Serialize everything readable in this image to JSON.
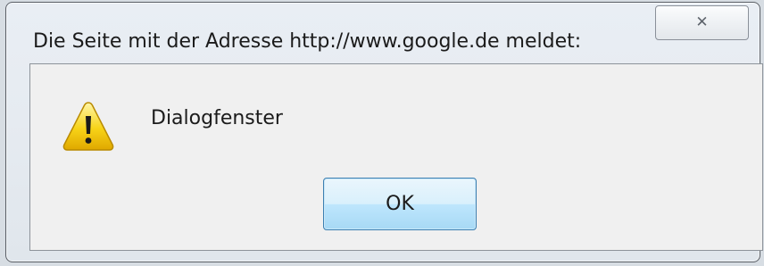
{
  "window": {
    "title": "Die Seite mit der Adresse http://www.google.de meldet:",
    "close_icon": "close-icon"
  },
  "dialog": {
    "icon": "warning-icon",
    "message": "Dialogfenster",
    "ok_label": "OK"
  },
  "colors": {
    "warning_yellow": "#f7d317",
    "ok_button_border": "#3c7fb1"
  }
}
